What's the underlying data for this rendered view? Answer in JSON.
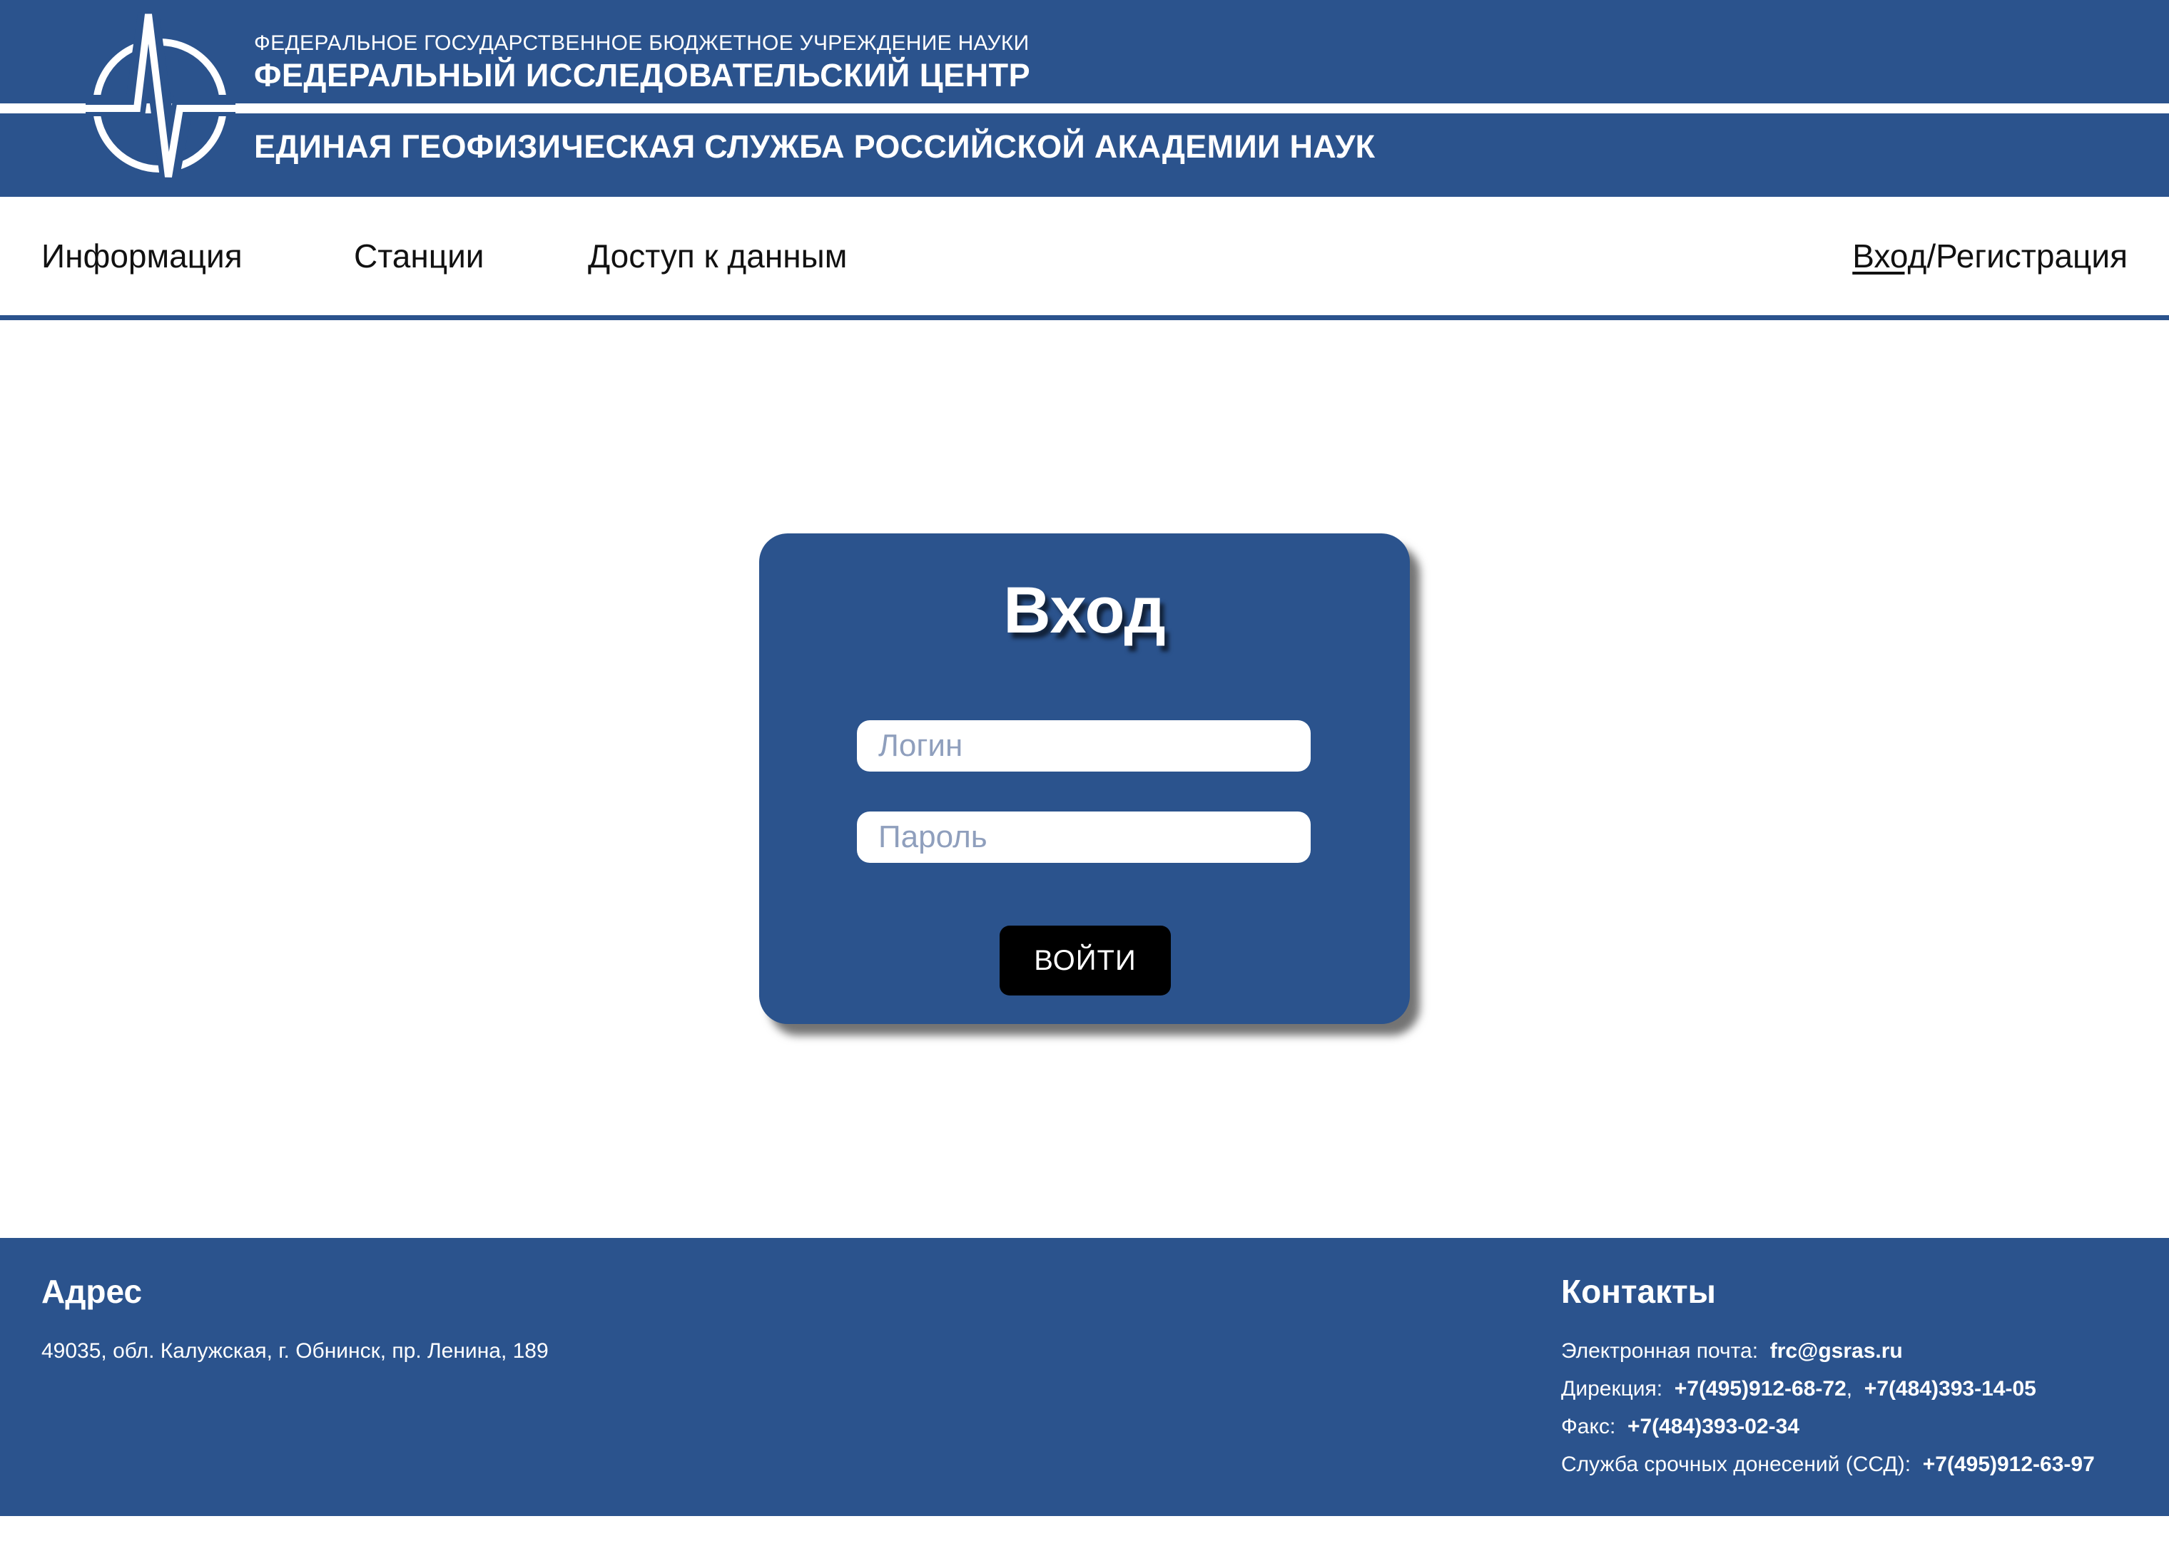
{
  "header": {
    "org_line1": "ФЕДЕРАЛЬНОЕ ГОСУДАРСТВЕННОЕ БЮДЖЕТНОЕ УЧРЕЖДЕНИЕ НАУКИ",
    "org_line2": "ФЕДЕРАЛЬНЫЙ ИССЛЕДОВАТЕЛЬСКИЙ ЦЕНТР",
    "org_line3": "ЕДИНАЯ ГЕОФИЗИЧЕСКАЯ СЛУЖБА РОССИЙСКОЙ АКАДЕМИИ НАУК",
    "logo_icon": "seismogram-circle-logo"
  },
  "nav": {
    "items": [
      {
        "label": "Информация"
      },
      {
        "label": "Станции"
      },
      {
        "label": "Доступ к данным"
      }
    ],
    "login_label": "Вход",
    "separator": "/",
    "register_label": "Регистрация"
  },
  "login_form": {
    "title": "Вход",
    "login_placeholder": "Логин",
    "login_value": "",
    "password_placeholder": "Пароль",
    "password_value": "",
    "submit_label": "ВОЙТИ"
  },
  "footer": {
    "address_heading": "Адрес",
    "address": "49035, обл. Калужская, г. Обнинск, пр. Ленина, 189",
    "contacts_heading": "Контакты",
    "email_label": "Электронная почта:",
    "email": "frc@gsras.ru",
    "direction_label": "Дирекция:",
    "direction_phone1": "+7(495)912-68-72",
    "direction_sep": ",",
    "direction_phone2": "+7(484)393-14-05",
    "fax_label": "Факс:",
    "fax": "+7(484)393-02-34",
    "emergency_label": "Служба срочных донесений (ССД):",
    "emergency_phone": "+7(495)912-63-97"
  },
  "colors": {
    "brand_blue": "#2b538d",
    "white": "#ffffff",
    "button_black": "#000000",
    "placeholder": "#8f9fbd"
  }
}
